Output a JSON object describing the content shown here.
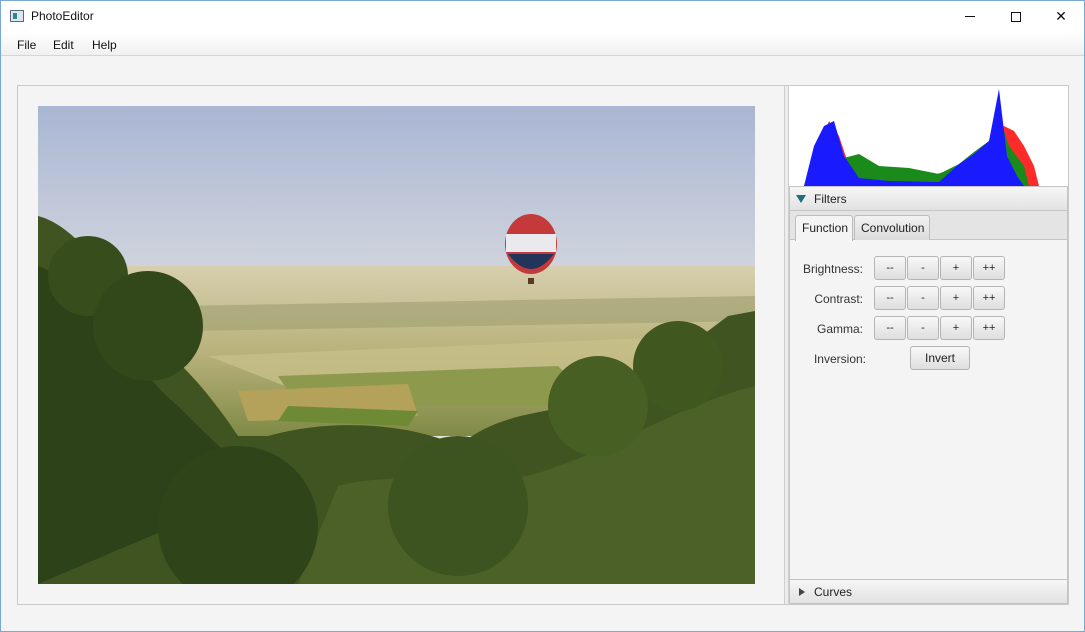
{
  "window": {
    "title": "PhotoEditor",
    "controls": {
      "minimize": "minimize",
      "maximize": "maximize",
      "close": "✕"
    }
  },
  "menu": {
    "items": [
      "File",
      "Edit",
      "Help"
    ]
  },
  "image_pane": {
    "image_icon": "landscape-photo"
  },
  "histogram": {
    "channels": [
      "red",
      "green",
      "blue"
    ],
    "colors": {
      "red": "#ff2b2b",
      "green": "#1a8a1a",
      "blue": "#1a1aff"
    }
  },
  "filters": {
    "title": "Filters",
    "expanded": true,
    "tabs": [
      {
        "label": "Function",
        "selected": true
      },
      {
        "label": "Convolution",
        "selected": false
      }
    ],
    "rows": [
      {
        "label": "Brightness:",
        "buttons": [
          "--",
          "-",
          "+",
          "++"
        ]
      },
      {
        "label": "Contrast:",
        "buttons": [
          "--",
          "-",
          "+",
          "++"
        ]
      },
      {
        "label": "Gamma:",
        "buttons": [
          "--",
          "-",
          "+",
          "++"
        ]
      }
    ],
    "inversion": {
      "label": "Inversion:",
      "button": "Invert"
    }
  },
  "curves": {
    "title": "Curves",
    "expanded": false
  }
}
